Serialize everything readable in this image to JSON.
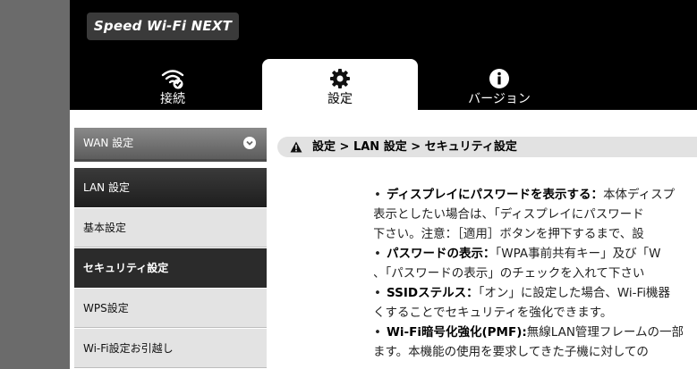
{
  "header": {
    "logo_text": "Speed Wi-Fi NEXT"
  },
  "tabs": [
    {
      "label": "接続",
      "icon": "wifi-check-icon",
      "active": false
    },
    {
      "label": "設定",
      "icon": "gear-icon",
      "active": true
    },
    {
      "label": "バージョン",
      "icon": "info-icon",
      "active": false
    }
  ],
  "sidebar": {
    "wan": "WAN 設定",
    "lan": "LAN 設定",
    "items": [
      "基本設定",
      "セキュリティ設定",
      "WPS設定",
      "Wi-Fi設定お引越し"
    ]
  },
  "breadcrumb": "設定 > LAN 設定 > セキュリティ設定",
  "content": {
    "l1_bold": "ディスプレイにパスワードを表示する：",
    "l1_text": "本体ディスプ",
    "l2": "を非表示としたい場合は、「ディスプレイにパスワード",
    "l3": "して下さい。注意：［適用］ボタンを押下するまで、設",
    "l4_bold": "パスワードの表示：",
    "l4_text": "「WPA事前共有キー」及び「W",
    "l5": "合は、「パスワードの表示」のチェックを入れて下さい",
    "l6_bold": "SSIDステルス：",
    "l6_text": "「オン」に設定した場合、Wi-Fi機器",
    "l7": "きなくすることでセキュリティを強化できます。",
    "l8_bold": "Wi-Fi暗号化強化(PMF):",
    "l8_text": "無線LAN管理フレームの一部",
    "l9": "にします。本機能の使用を要求してきた子機に対しての"
  }
}
